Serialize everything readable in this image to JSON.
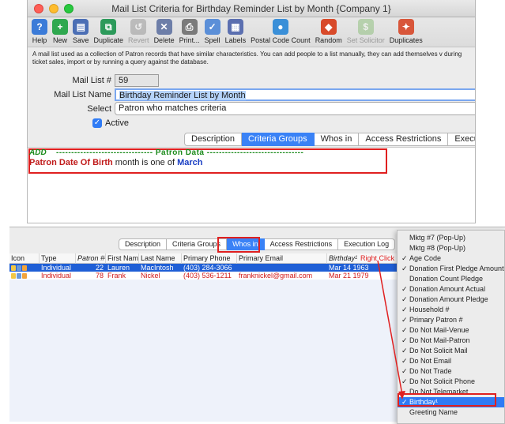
{
  "window": {
    "title": "Mail List Criteria for Birthday Reminder List by Month {Company 1}"
  },
  "toolbar": [
    {
      "label": "Help",
      "icon": "help-icon",
      "color": "#3b7bd8",
      "glyph": "?",
      "disabled": false
    },
    {
      "label": "New",
      "icon": "new-icon",
      "color": "#2fa84f",
      "glyph": "+",
      "disabled": false
    },
    {
      "label": "Save",
      "icon": "save-icon",
      "color": "#4c6fb5",
      "glyph": "▤",
      "disabled": false
    },
    {
      "label": "Duplicate",
      "icon": "duplicate-icon",
      "color": "#2c9a5a",
      "glyph": "⧉",
      "disabled": false
    },
    {
      "label": "Revert",
      "icon": "revert-icon",
      "color": "#8a8a8a",
      "glyph": "↺",
      "disabled": true
    },
    {
      "label": "Delete",
      "icon": "delete-icon",
      "color": "#6d7ea8",
      "glyph": "✕",
      "disabled": false
    },
    {
      "label": "Print...",
      "icon": "print-icon",
      "color": "#7a7a7a",
      "glyph": "⎙",
      "disabled": false
    },
    {
      "label": "Spell",
      "icon": "spell-icon",
      "color": "#5b8fd8",
      "glyph": "✓",
      "disabled": false
    },
    {
      "label": "Labels",
      "icon": "labels-icon",
      "color": "#5b6fb0",
      "glyph": "▦",
      "disabled": false
    },
    {
      "label": "Postal Code Count",
      "icon": "postal-code-icon",
      "color": "#3a8fd8",
      "glyph": "●",
      "disabled": false
    },
    {
      "label": "Random",
      "icon": "random-icon",
      "color": "#d84a2a",
      "glyph": "◆",
      "disabled": false
    },
    {
      "label": "Set Solicitor",
      "icon": "set-solicitor-icon",
      "color": "#7fb96a",
      "glyph": "$",
      "disabled": true
    },
    {
      "label": "Duplicates",
      "icon": "duplicates-icon",
      "color": "#d8563a",
      "glyph": "✦",
      "disabled": false
    }
  ],
  "description": "A mail list used as a collection of Patron records that have similar characteristics.  You can add people to a list manually, they can add themselves v during ticket sales, import or by running a query against the database.",
  "form": {
    "mail_list_num_label": "Mail List #",
    "mail_list_num_value": "59",
    "mail_list_name_label": "Mail List Name",
    "mail_list_name_value": "Birthday Reminder List by Month",
    "select_label": "Select",
    "select_value": "Patron who matches criteria",
    "active_label": "Active",
    "active_checked": true
  },
  "tabs_top": [
    "Description",
    "Criteria Groups",
    "Whos in",
    "Access Restrictions",
    "Execution Log"
  ],
  "tabs_top_active": "Criteria Groups",
  "criteria": {
    "add_label": "ADD",
    "section_label": "-------------------------------- Patron Data --------------------------------",
    "field": "Patron Date Of Birth",
    "operator": "month is one of",
    "value": "March"
  },
  "tabs_bottom": [
    "Description",
    "Criteria Groups",
    "Whos in",
    "Access Restrictions",
    "Execution Log"
  ],
  "tabs_bottom_active": "Whos in",
  "grid": {
    "headers": {
      "icon": "Icon",
      "type": "Type",
      "patron_num": "Patron #²",
      "first_name": "First Name",
      "last_name": "Last Name",
      "primary_phone": "Primary Phone",
      "primary_email": "Primary Email",
      "birthday": "Birthday",
      "birthday_sup": "1"
    },
    "annotation": "Right Click",
    "rows": [
      {
        "type": "Individual",
        "patron_num": "22",
        "first_name": "Lauren",
        "last_name": "MacIntosh",
        "phone": "(403) 284-3066",
        "email": "",
        "birthday": "Mar 14 1963"
      },
      {
        "type": "Individual",
        "patron_num": "78",
        "first_name": "Frank",
        "last_name": "Nickel",
        "phone": "(403) 536-1211",
        "email": "franknickel@gmail.com",
        "birthday": "Mar 21 1979"
      }
    ]
  },
  "context_menu": [
    {
      "label": "Mktg #7 (Pop-Up)",
      "checked": false
    },
    {
      "label": "Mktg #8 (Pop-Up)",
      "checked": false
    },
    {
      "label": "Age Code",
      "checked": true
    },
    {
      "label": "Donation First Pledge Amount",
      "checked": true
    },
    {
      "label": "Donation Count Pledge",
      "checked": false
    },
    {
      "label": "Donation Amount Actual",
      "checked": true
    },
    {
      "label": "Donation Amount Pledge",
      "checked": true
    },
    {
      "label": "Household #",
      "checked": true
    },
    {
      "label": "Primary Patron #",
      "checked": true
    },
    {
      "label": "Do Not Mail-Venue",
      "checked": true
    },
    {
      "label": "Do Not Mail-Patron",
      "checked": true
    },
    {
      "label": "Do Not Solicit Mail",
      "checked": true
    },
    {
      "label": "Do Not Email",
      "checked": true
    },
    {
      "label": "Do Not Trade",
      "checked": true
    },
    {
      "label": "Do Not Solicit Phone",
      "checked": true
    },
    {
      "label": "Do Not Telemarket",
      "checked": false
    },
    {
      "label": "Birthday¹",
      "checked": true,
      "highlighted": true
    },
    {
      "label": "Greeting Name",
      "checked": false
    }
  ],
  "colors": {
    "accent": "#2f7bf5",
    "annotation_red": "#e02020",
    "criteria_green": "#1a8a1a",
    "criteria_field_red": "#c01a1a",
    "criteria_value_blue": "#1a3fc4"
  }
}
